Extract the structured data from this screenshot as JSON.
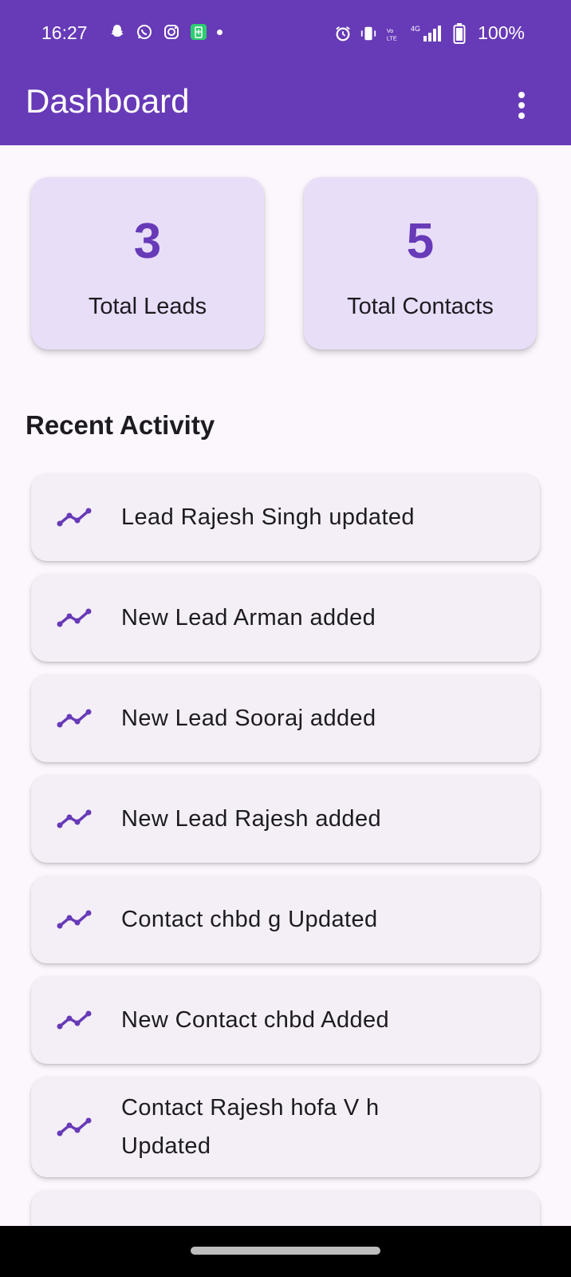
{
  "status": {
    "time": "16:27",
    "battery": "100%",
    "network": "4G"
  },
  "appbar": {
    "title": "Dashboard",
    "menu_icon": "more-vert-icon"
  },
  "stats": [
    {
      "value": "3",
      "label": "Total Leads"
    },
    {
      "value": "5",
      "label": "Total Contacts"
    }
  ],
  "recent": {
    "title": "Recent Activity",
    "icon": "trending-icon",
    "items": [
      "Lead Rajesh Singh updated",
      "New Lead Arman added",
      "New Lead Sooraj added",
      "New Lead Rajesh added",
      "Contact chbd g Updated",
      "New Contact chbd Added",
      "Contact Rajesh hofa V h Updated"
    ]
  },
  "colors": {
    "primary": "#673ab7",
    "card_bg": "#e8def8",
    "list_bg": "#f4eff6",
    "page_bg": "#fcf6fd"
  }
}
